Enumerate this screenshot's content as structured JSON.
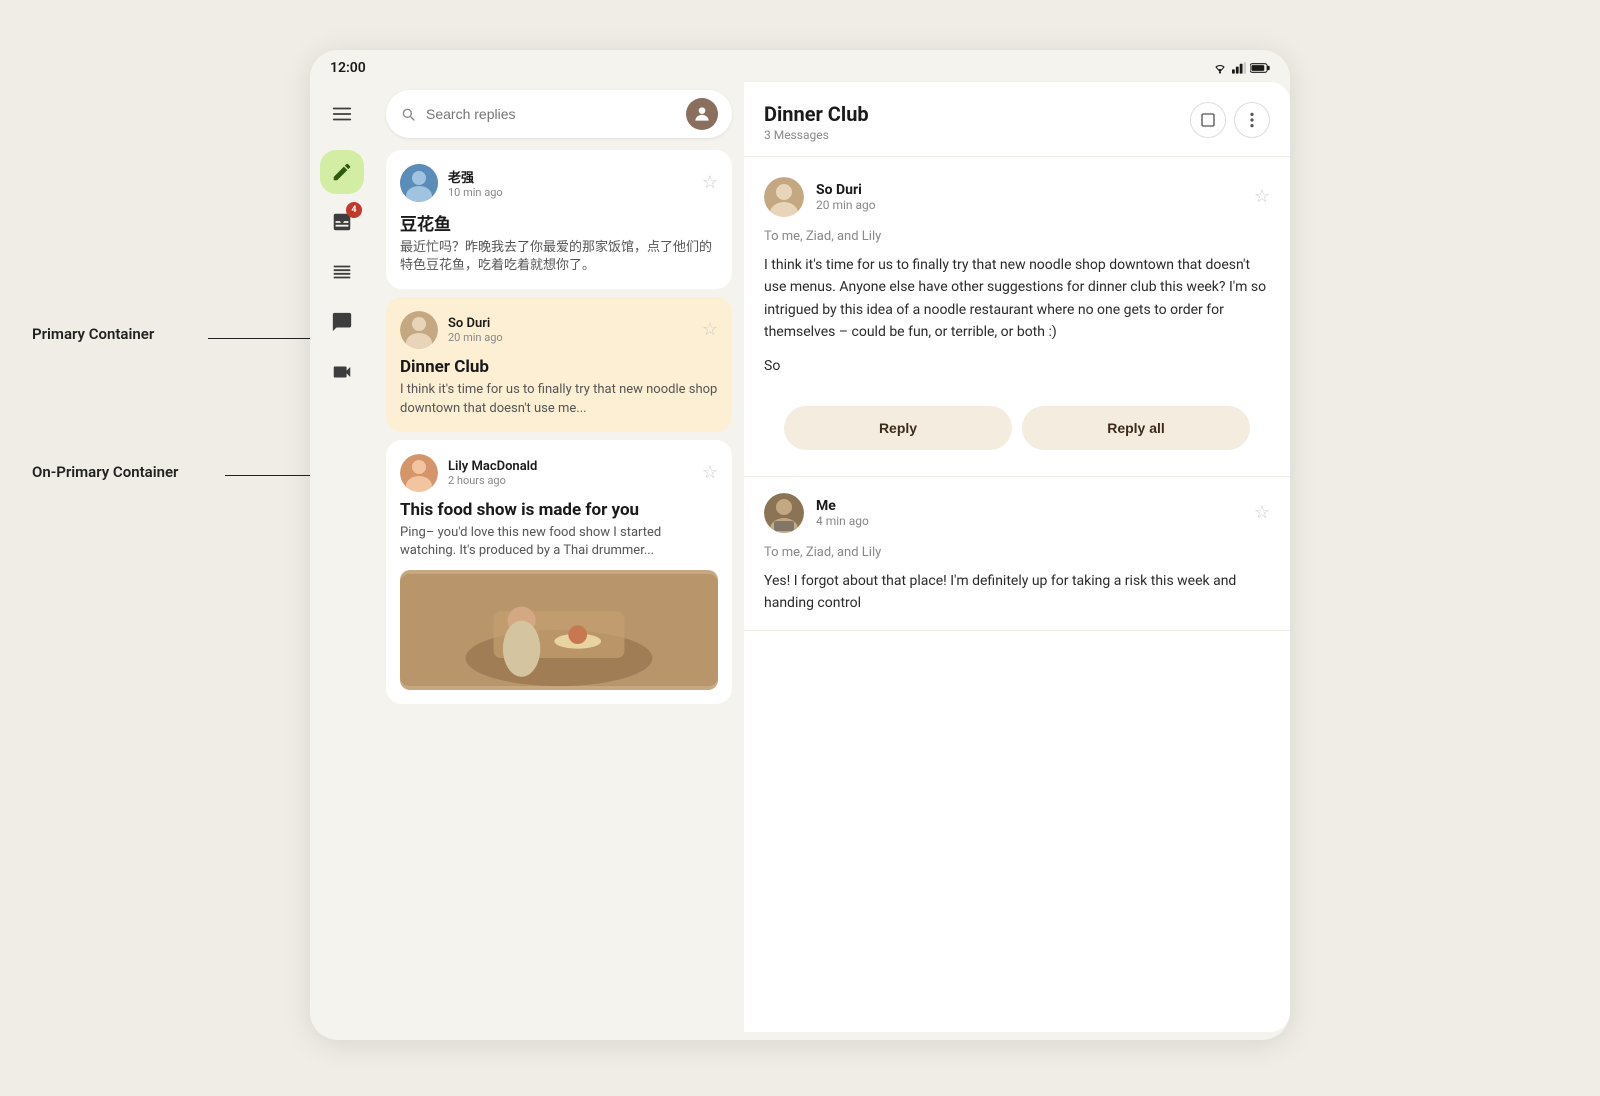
{
  "statusBar": {
    "time": "12:00",
    "icons": [
      "wifi",
      "signal",
      "battery"
    ]
  },
  "nav": {
    "items": [
      {
        "name": "menu",
        "icon": "menu",
        "badge": null
      },
      {
        "name": "compose",
        "icon": "edit",
        "badge": null
      },
      {
        "name": "inbox",
        "icon": "inbox",
        "badge": "4"
      },
      {
        "name": "list",
        "icon": "list",
        "badge": null
      },
      {
        "name": "chat",
        "icon": "chat",
        "badge": null
      },
      {
        "name": "video",
        "icon": "video",
        "badge": null
      }
    ]
  },
  "search": {
    "placeholder": "Search replies"
  },
  "emailList": {
    "emails": [
      {
        "id": "1",
        "sender": "老强",
        "time": "10 min ago",
        "subject": "豆花鱼",
        "preview": "最近忙吗？昨晚我去了你最爱的那家饭馆，点了他们的特色豆花鱼，吃着吃着就想你了。",
        "avatarColor": "#5b8db8",
        "hasImage": false,
        "selected": false
      },
      {
        "id": "2",
        "sender": "So Duri",
        "time": "20 min ago",
        "subject": "Dinner Club",
        "preview": "I think it's time for us to finally try that new noodle shop downtown that doesn't use me...",
        "avatarColor": "#c4a882",
        "hasImage": false,
        "selected": true
      },
      {
        "id": "3",
        "sender": "Lily MacDonald",
        "time": "2 hours ago",
        "subject": "This food show is made for you",
        "preview": "Ping– you'd love this new food show I started watching. It's produced by a Thai drummer...",
        "avatarColor": "#d4956b",
        "hasImage": true,
        "selected": false
      }
    ]
  },
  "emailDetail": {
    "subject": "Dinner Club",
    "messagesCount": "3 Messages",
    "messages": [
      {
        "id": "msg1",
        "sender": "So Duri",
        "time": "20 min ago",
        "to": "To me, Ziad, and Lily",
        "body": "I think it's time for us to finally try that new noodle shop downtown that doesn't use menus. Anyone else have other suggestions for dinner club this week? I'm so intrigued by this idea of a noodle restaurant where no one gets to order for themselves – could be fun, or terrible, or both :)",
        "signature": "So",
        "avatarColor": "#c4a882",
        "showReply": true
      },
      {
        "id": "msg2",
        "sender": "Me",
        "time": "4 min ago",
        "to": "To me, Ziad, and Lily",
        "body": "Yes! I forgot about that place! I'm definitely up for taking a risk this week and handing control",
        "avatarColor": "#8B7355",
        "showReply": false
      }
    ],
    "replyLabel": "Reply",
    "replyAllLabel": "Reply all"
  },
  "annotations": {
    "primaryContainer": "Primary Container",
    "onPrimaryContainer": "On-Primary Container"
  }
}
